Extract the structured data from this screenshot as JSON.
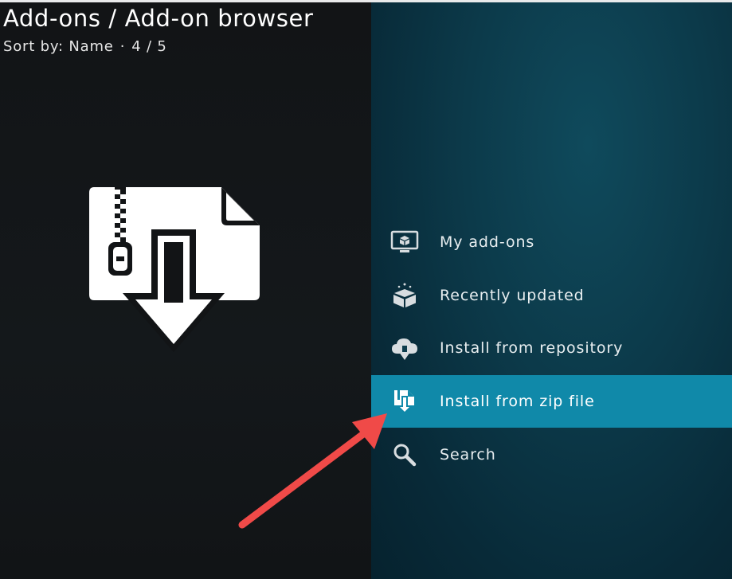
{
  "header": {
    "title": "Add-ons / Add-on browser",
    "sort_label": "Sort by: Name",
    "separator": "·",
    "position": "4 / 5"
  },
  "preview": {
    "icon": "zip-download-icon"
  },
  "menu": {
    "selected_index": 3,
    "items": [
      {
        "label": "My add-ons",
        "icon": "monitor-box-icon"
      },
      {
        "label": "Recently updated",
        "icon": "open-box-icon"
      },
      {
        "label": "Install from repository",
        "icon": "cloud-download-icon"
      },
      {
        "label": "Install from zip file",
        "icon": "zip-file-icon"
      },
      {
        "label": "Search",
        "icon": "search-icon"
      }
    ]
  },
  "colors": {
    "accent": "#1089a9",
    "annotation_arrow": "#f04a48",
    "left_bg": "#121416",
    "right_bg": "#0c3a4a"
  }
}
